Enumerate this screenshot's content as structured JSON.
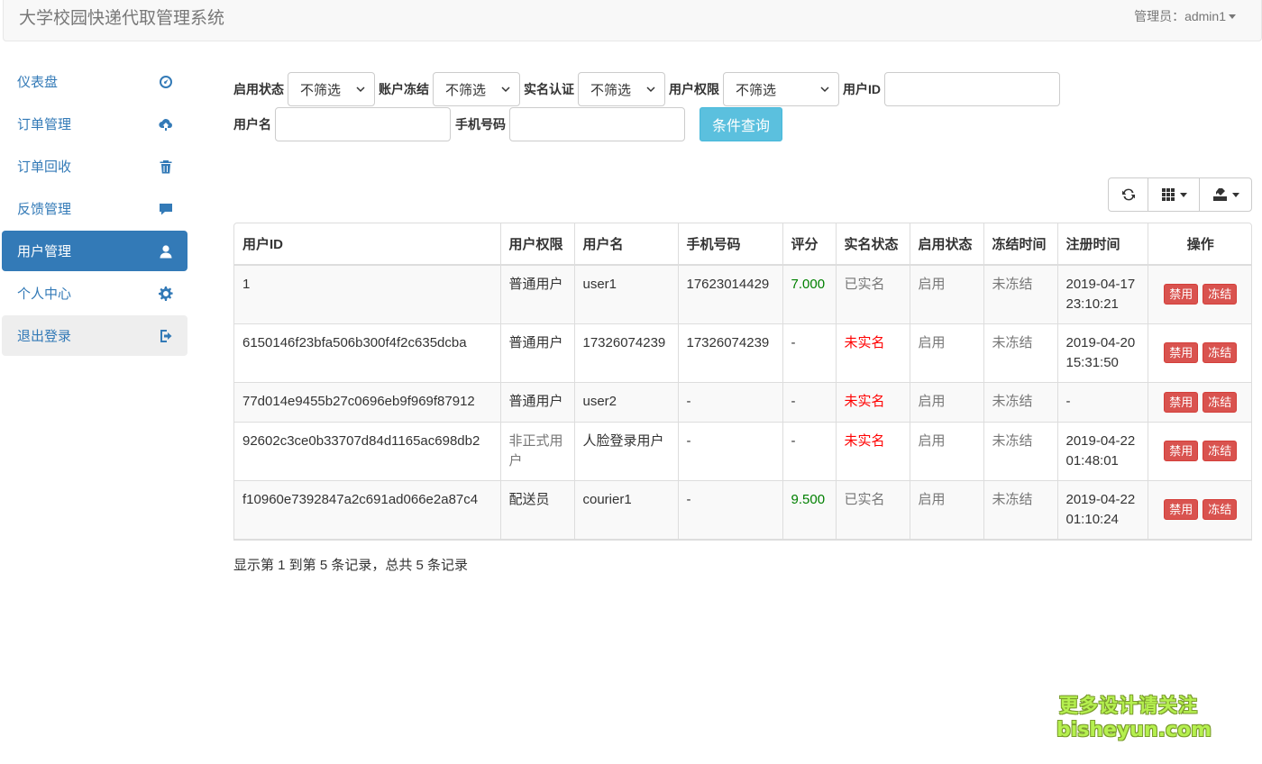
{
  "header": {
    "title": "大学校园快递代取管理系统",
    "admin_label": "管理员：admin1"
  },
  "sidebar": {
    "items": [
      {
        "label": "仪表盘",
        "icon": "dashboard-icon"
      },
      {
        "label": "订单管理",
        "icon": "cloud-upload-icon"
      },
      {
        "label": "订单回收",
        "icon": "trash-icon"
      },
      {
        "label": "反馈管理",
        "icon": "comment-icon"
      },
      {
        "label": "用户管理",
        "icon": "user-icon",
        "active": true
      },
      {
        "label": "个人中心",
        "icon": "gear-icon"
      },
      {
        "label": "退出登录",
        "icon": "logout-icon"
      }
    ]
  },
  "filters": {
    "enable_status": {
      "label": "启用状态",
      "value": "不筛选"
    },
    "account_freeze": {
      "label": "账户冻结",
      "value": "不筛选"
    },
    "realname": {
      "label": "实名认证",
      "value": "不筛选"
    },
    "permission": {
      "label": "用户权限",
      "value": "不筛选"
    },
    "user_id": {
      "label": "用户ID",
      "value": ""
    },
    "username": {
      "label": "用户名",
      "value": ""
    },
    "phone": {
      "label": "手机号码",
      "value": ""
    },
    "query_button": "条件查询"
  },
  "toolbar": {
    "icons": [
      "refresh-icon",
      "columns-icon",
      "export-icon"
    ]
  },
  "table": {
    "headers": [
      "用户ID",
      "用户权限",
      "用户名",
      "手机号码",
      "评分",
      "实名状态",
      "启用状态",
      "冻结时间",
      "注册时间",
      "操作"
    ],
    "rows": [
      {
        "id": "1",
        "role": "普通用户",
        "username": "user1",
        "phone": "17623014429",
        "score": "7.000",
        "realname": "已实名",
        "enabled": "启用",
        "freeze": "未冻结",
        "reg_date": "2019-04-17",
        "reg_time": "23:10:21"
      },
      {
        "id": "6150146f23bfa506b300f4f2c635dcba",
        "role": "普通用户",
        "username": "17326074239",
        "phone": "17326074239",
        "score": "-",
        "realname": "未实名",
        "enabled": "启用",
        "freeze": "未冻结",
        "reg_date": "2019-04-20",
        "reg_time": "15:31:50"
      },
      {
        "id": "77d014e9455b27c0696eb9f969f87912",
        "role": "普通用户",
        "username": "user2",
        "phone": "-",
        "score": "-",
        "realname": "未实名",
        "enabled": "启用",
        "freeze": "未冻结",
        "reg_date": "-",
        "reg_time": ""
      },
      {
        "id": "92602c3ce0b33707d84d1165ac698db2",
        "role": "非正式用户",
        "username": "人脸登录用户",
        "phone": "-",
        "score": "-",
        "realname": "未实名",
        "enabled": "启用",
        "freeze": "未冻结",
        "reg_date": "2019-04-22",
        "reg_time": "01:48:01"
      },
      {
        "id": "f10960e7392847a2c691ad066e2a87c4",
        "role": "配送员",
        "username": "courier1",
        "phone": "-",
        "score": "9.500",
        "realname": "已实名",
        "enabled": "启用",
        "freeze": "未冻结",
        "reg_date": "2019-04-22",
        "reg_time": "01:10:24"
      }
    ],
    "actions": {
      "disable": "禁用",
      "freeze": "冻结"
    }
  },
  "pagination": {
    "summary": "显示第 1 到第 5 条记录，总共 5 条记录"
  },
  "watermark": {
    "line1": "更多设计请关注",
    "line2": "bisheyun.com"
  },
  "colors": {
    "primary": "#337ab7",
    "info": "#5bc0de",
    "danger": "#d9534f",
    "green": "#008000",
    "red": "#ff0000"
  }
}
